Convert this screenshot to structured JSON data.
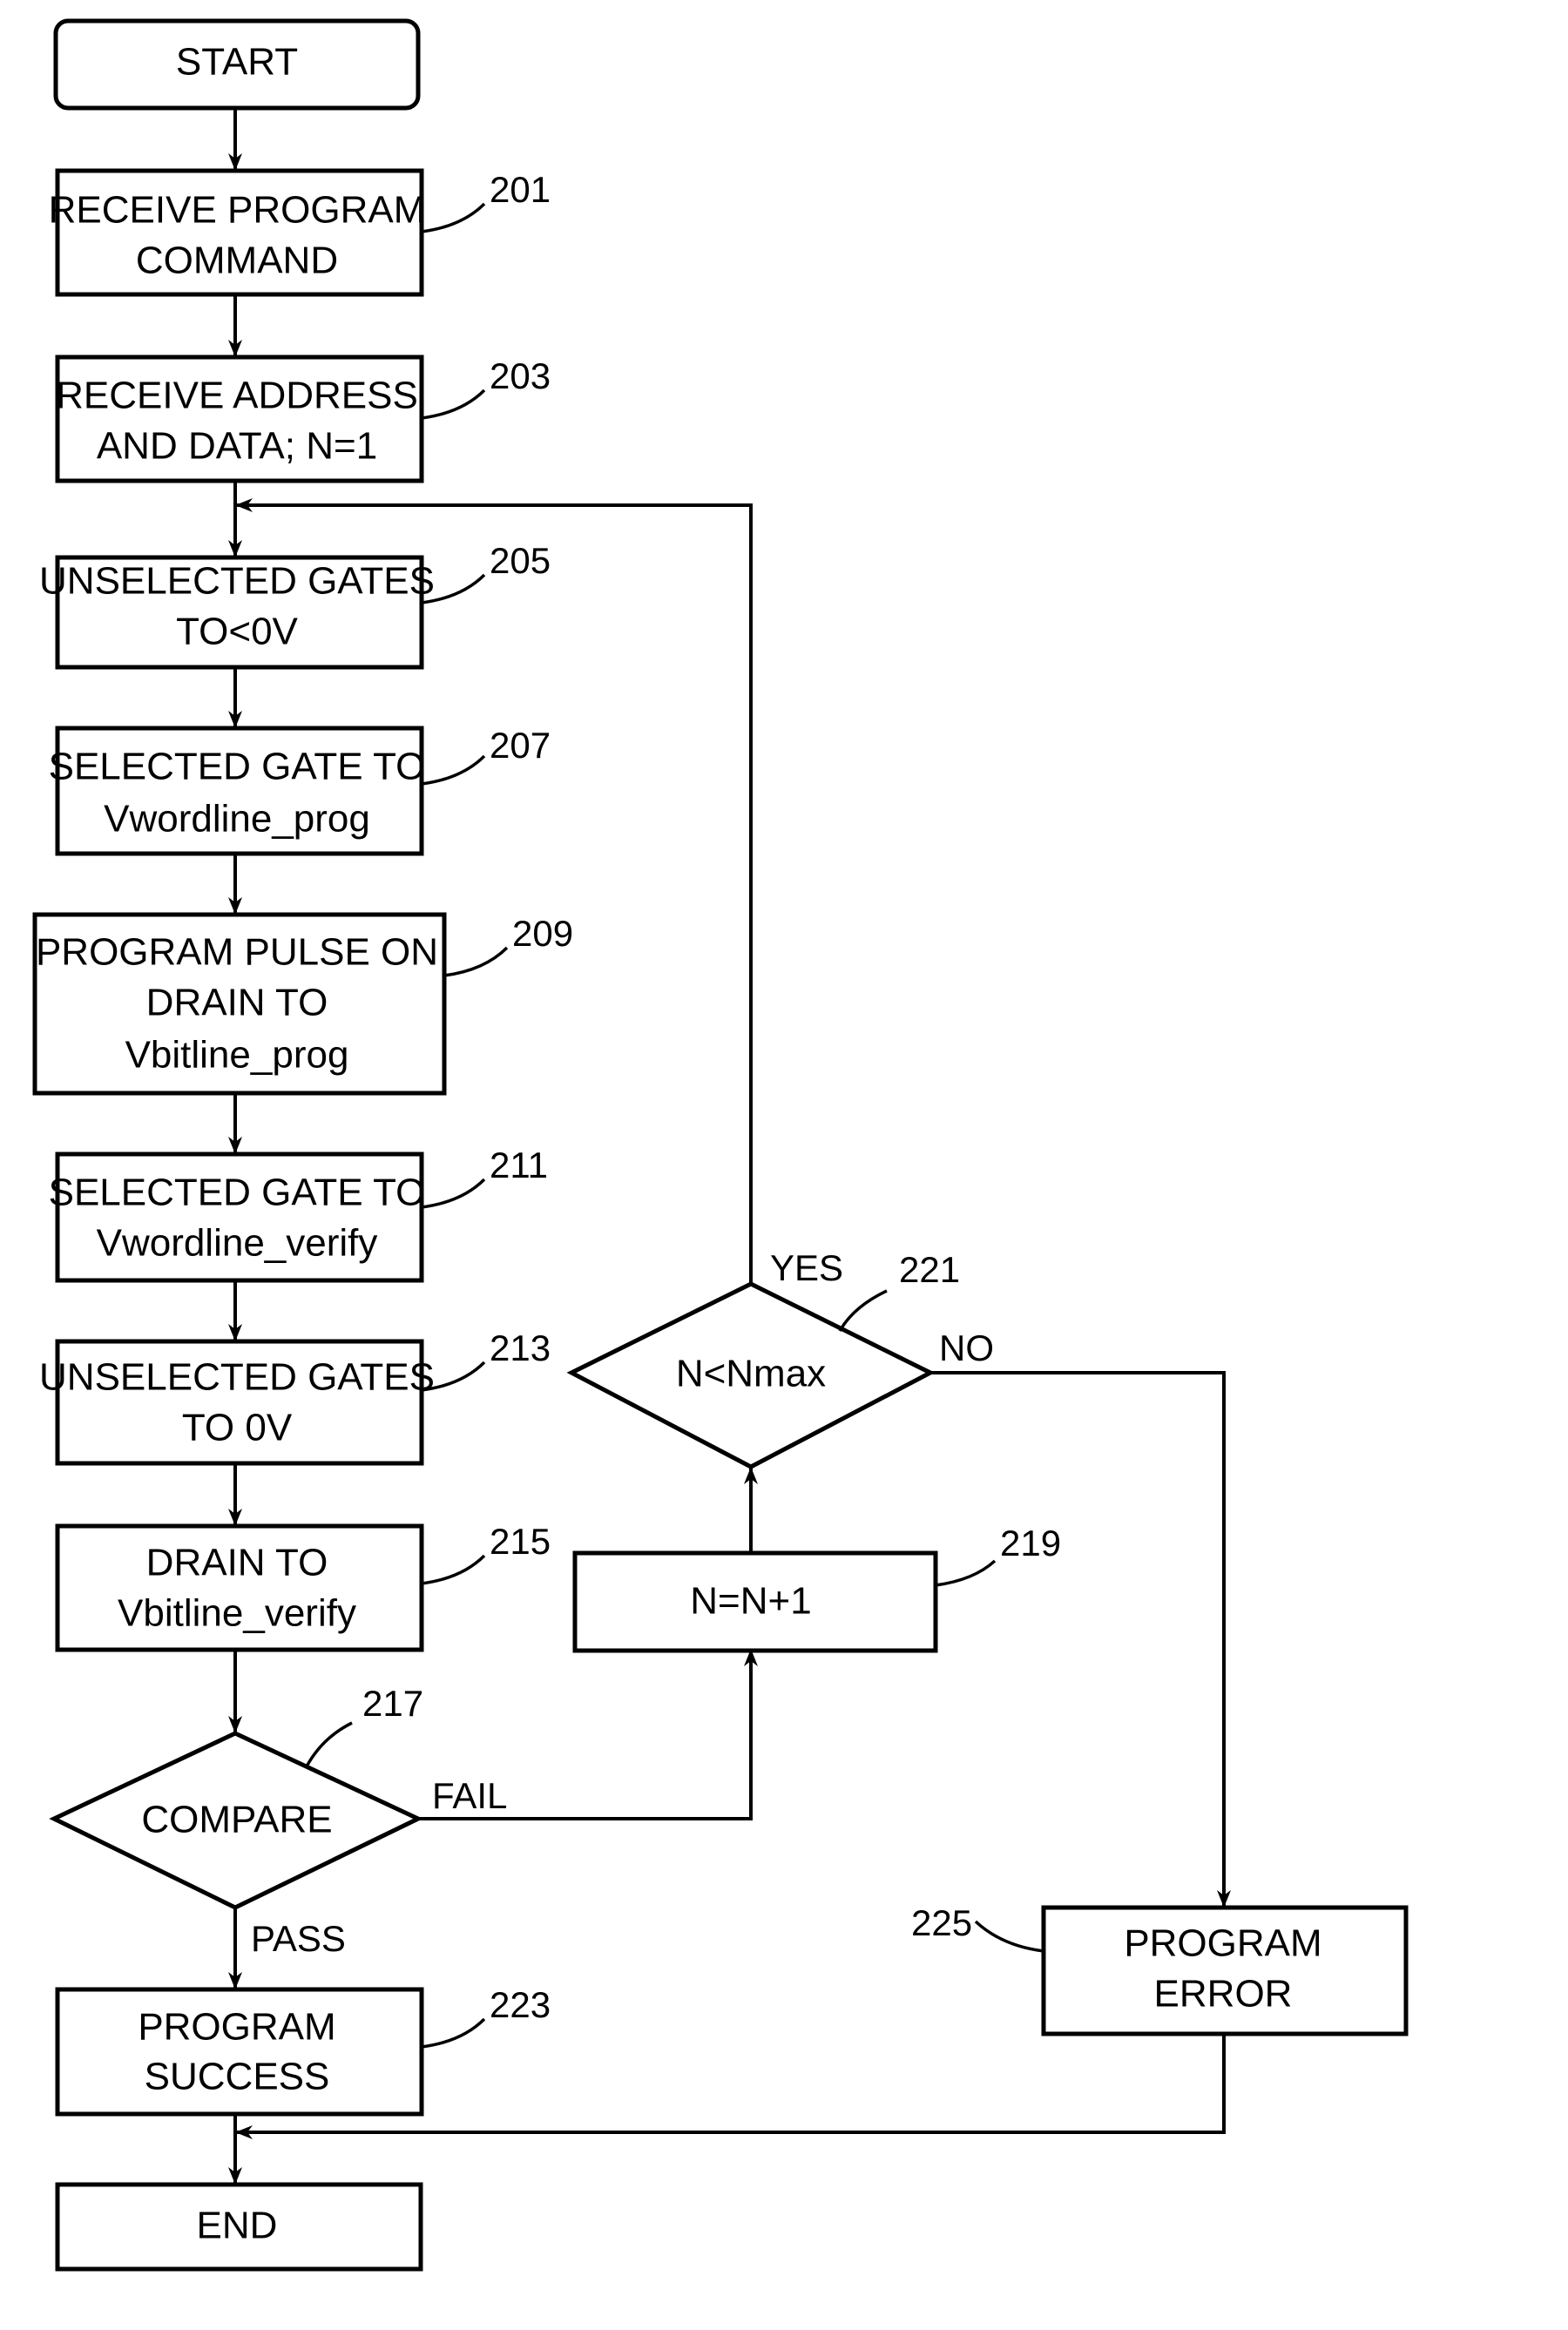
{
  "diagram": {
    "type": "flowchart",
    "nodes": [
      {
        "id": "start",
        "shape": "rounded",
        "lines": [
          "START"
        ],
        "ref": ""
      },
      {
        "id": "n201",
        "shape": "rect",
        "lines": [
          "RECEIVE PROGRAM",
          "COMMAND"
        ],
        "ref": "201"
      },
      {
        "id": "n203",
        "shape": "rect",
        "lines": [
          "RECEIVE ADDRESS",
          "AND DATA; N=1"
        ],
        "ref": "203"
      },
      {
        "id": "n205",
        "shape": "rect",
        "lines": [
          "UNSELECTED GATES",
          "TO<0V"
        ],
        "ref": "205"
      },
      {
        "id": "n207",
        "shape": "rect",
        "lines": [
          "SELECTED GATE TO",
          "Vwordline_prog"
        ],
        "ref": "207"
      },
      {
        "id": "n209",
        "shape": "rect",
        "lines": [
          "PROGRAM PULSE ON",
          "DRAIN TO",
          "Vbitline_prog"
        ],
        "ref": "209"
      },
      {
        "id": "n211",
        "shape": "rect",
        "lines": [
          "SELECTED GATE TO",
          "Vwordline_verify"
        ],
        "ref": "211"
      },
      {
        "id": "n213",
        "shape": "rect",
        "lines": [
          "UNSELECTED GATES",
          "TO 0V"
        ],
        "ref": "213"
      },
      {
        "id": "n215",
        "shape": "rect",
        "lines": [
          "DRAIN TO",
          "Vbitline_verify"
        ],
        "ref": "215"
      },
      {
        "id": "n217",
        "shape": "diamond",
        "lines": [
          "COMPARE"
        ],
        "ref": "217"
      },
      {
        "id": "n219",
        "shape": "rect",
        "lines": [
          "N=N+1"
        ],
        "ref": "219"
      },
      {
        "id": "n221",
        "shape": "diamond",
        "lines": [
          "N<Nmax"
        ],
        "ref": "221"
      },
      {
        "id": "n223",
        "shape": "rect",
        "lines": [
          "PROGRAM",
          "SUCCESS"
        ],
        "ref": "223"
      },
      {
        "id": "n225",
        "shape": "rect",
        "lines": [
          "PROGRAM",
          "ERROR"
        ],
        "ref": "225"
      },
      {
        "id": "end",
        "shape": "rect",
        "lines": [
          "END"
        ],
        "ref": ""
      }
    ],
    "edge_labels": {
      "fail": "FAIL",
      "pass": "PASS",
      "yes": "YES",
      "no": "NO"
    },
    "edges": [
      {
        "from": "start",
        "to": "n201",
        "label": ""
      },
      {
        "from": "n201",
        "to": "n203",
        "label": ""
      },
      {
        "from": "n203",
        "to": "n205",
        "label": ""
      },
      {
        "from": "n205",
        "to": "n207",
        "label": ""
      },
      {
        "from": "n207",
        "to": "n209",
        "label": ""
      },
      {
        "from": "n209",
        "to": "n211",
        "label": ""
      },
      {
        "from": "n211",
        "to": "n213",
        "label": ""
      },
      {
        "from": "n213",
        "to": "n215",
        "label": ""
      },
      {
        "from": "n215",
        "to": "n217",
        "label": ""
      },
      {
        "from": "n217",
        "to": "n223",
        "label": "PASS"
      },
      {
        "from": "n217",
        "to": "n219",
        "label": "FAIL"
      },
      {
        "from": "n219",
        "to": "n221",
        "label": ""
      },
      {
        "from": "n221",
        "to": "n205",
        "label": "YES"
      },
      {
        "from": "n221",
        "to": "n225",
        "label": "NO"
      },
      {
        "from": "n223",
        "to": "end",
        "label": ""
      },
      {
        "from": "n225",
        "to": "end",
        "label": ""
      }
    ]
  }
}
